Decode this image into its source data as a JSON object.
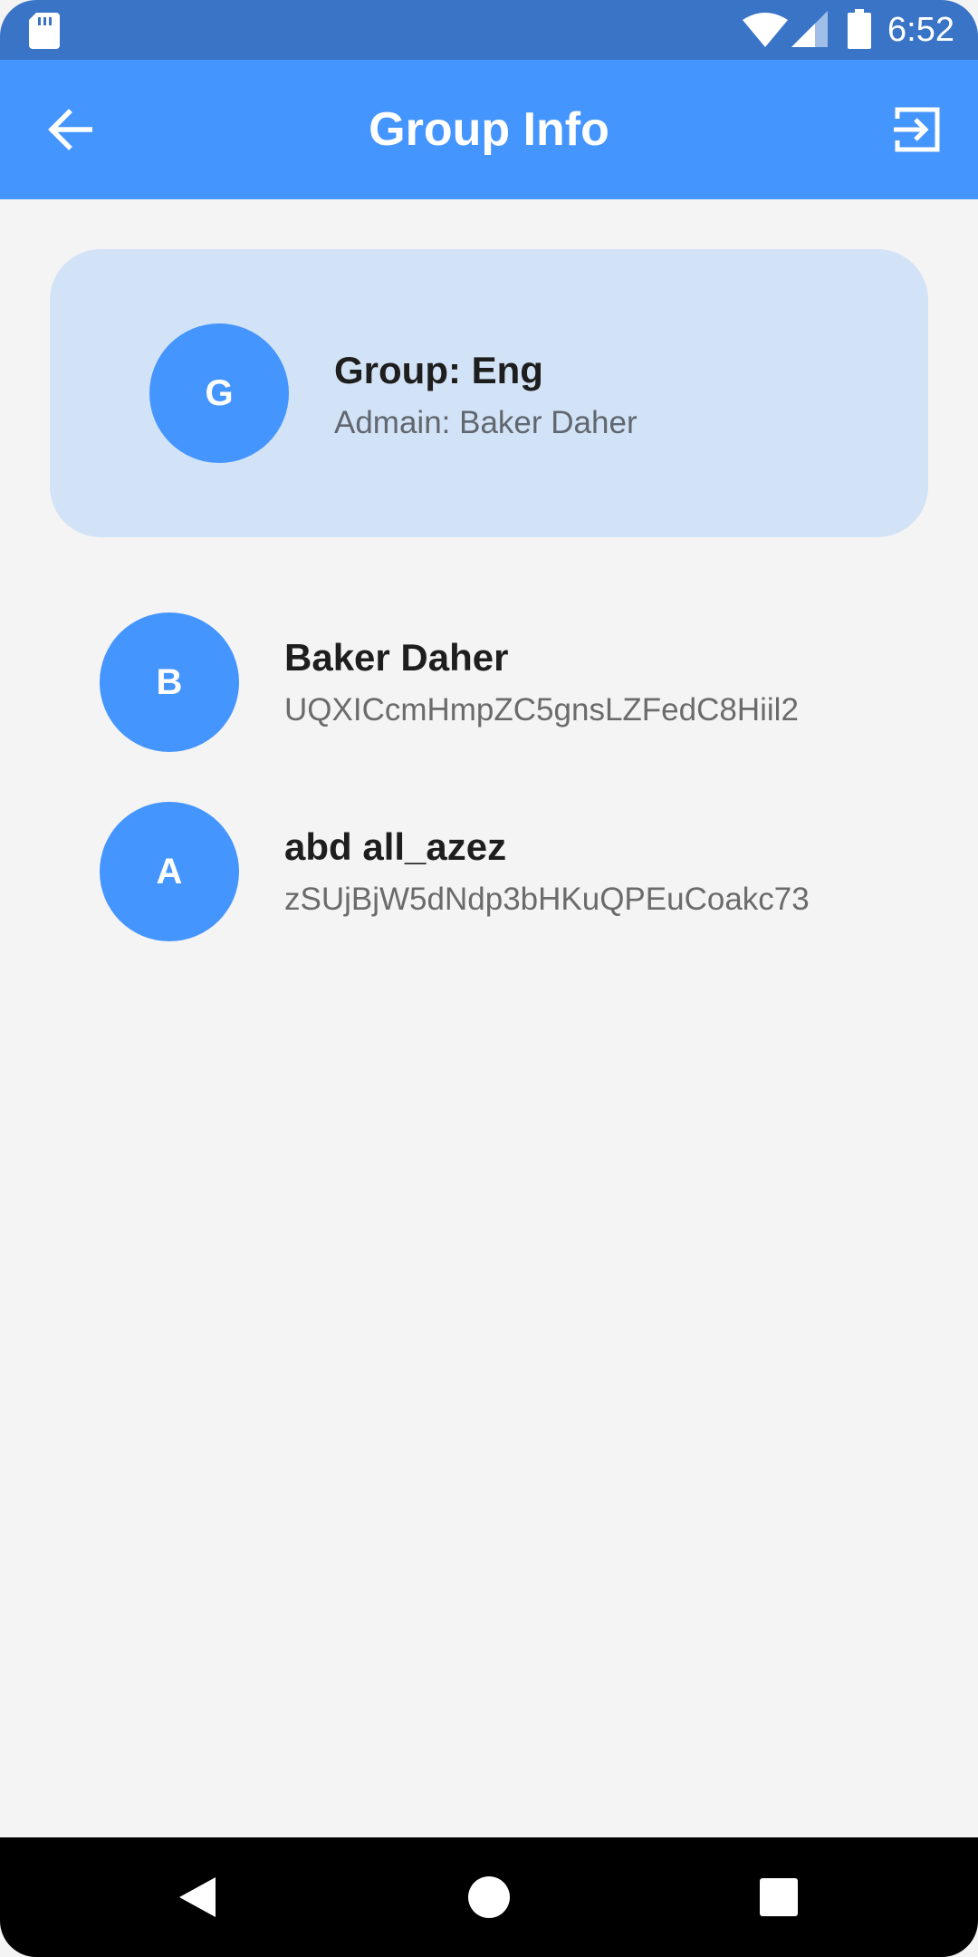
{
  "status_bar": {
    "time": "6:52",
    "icons": [
      "sd-card-icon",
      "wifi-icon",
      "cell-signal-icon",
      "battery-icon"
    ]
  },
  "app_bar": {
    "title": "Group Info",
    "back_icon": "arrow-back-icon",
    "exit_icon": "exit-to-app-icon"
  },
  "group": {
    "avatar_letter": "G",
    "name": "Group: Eng",
    "admin": "Admain: Baker Daher"
  },
  "members": [
    {
      "avatar_letter": "B",
      "name": "Baker Daher",
      "id": "UQXICcmHmpZC5gnsLZFedC8Hiil2"
    },
    {
      "avatar_letter": "A",
      "name": "abd all_azez",
      "id": "zSUjBjW5dNdp3bHKuQPEuCoakc73"
    }
  ],
  "nav_bar": {
    "icons": [
      "nav-back-icon",
      "nav-home-icon",
      "nav-recents-icon"
    ]
  },
  "colors": {
    "status_bar": "#3a74c6",
    "app_bar": "#4595ff",
    "avatar": "#4595ff",
    "card": "#d3e3f7",
    "background": "#f4f4f4"
  }
}
